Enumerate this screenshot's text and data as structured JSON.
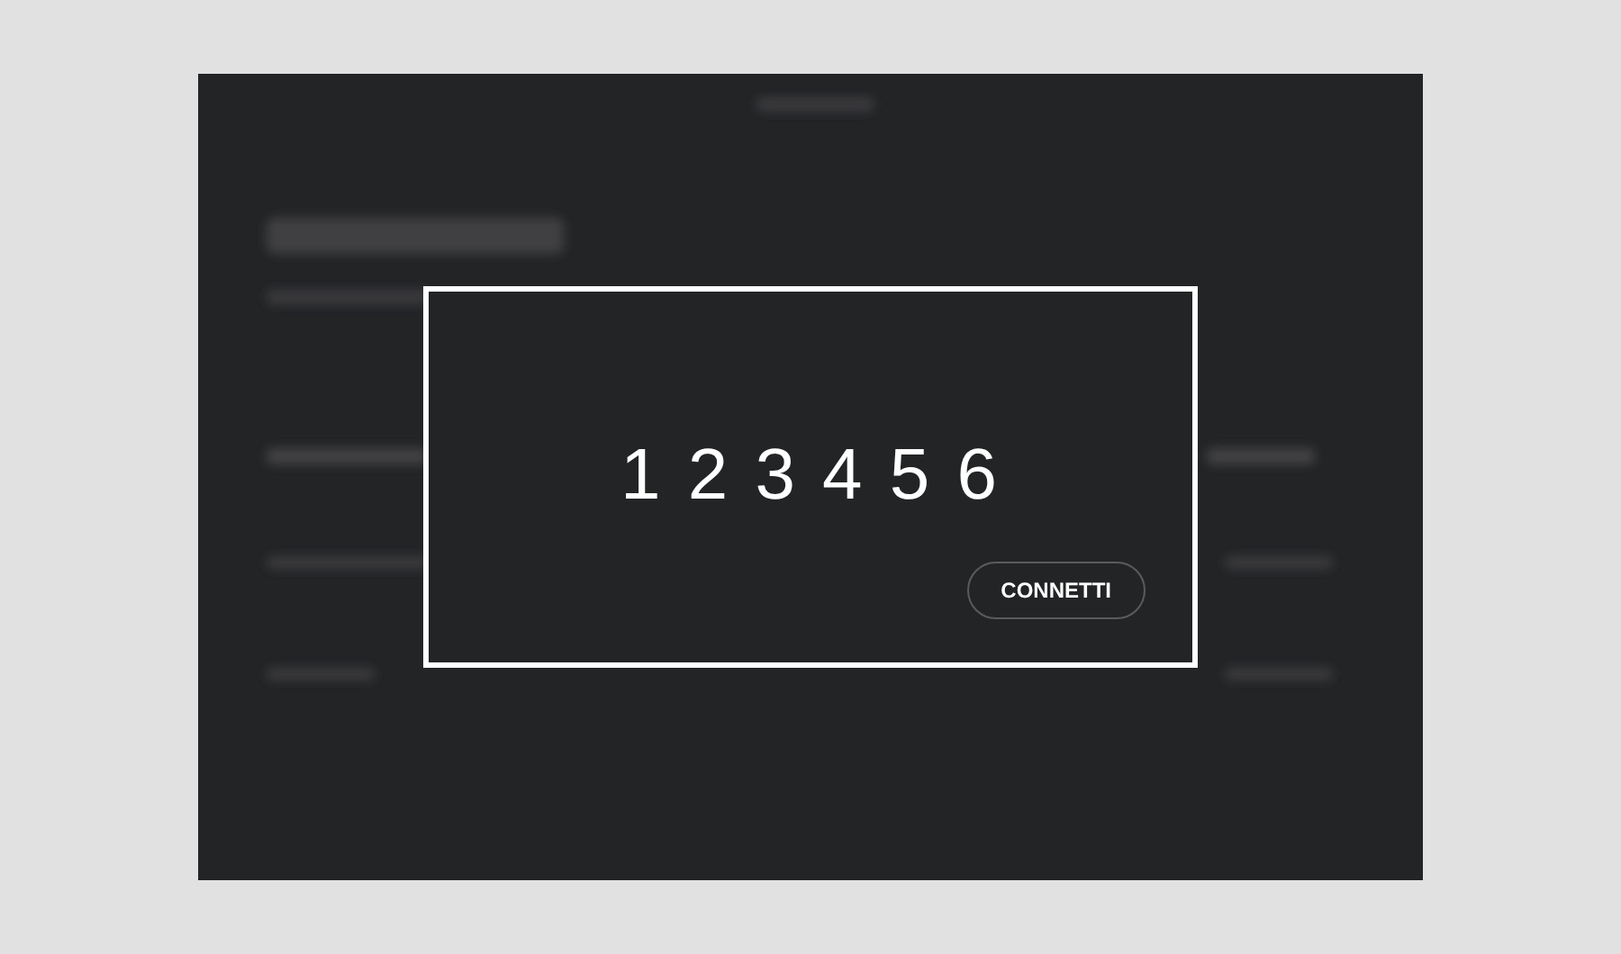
{
  "dialog": {
    "code": "1 2 3 4 5 6",
    "button": "CONNETTI"
  }
}
